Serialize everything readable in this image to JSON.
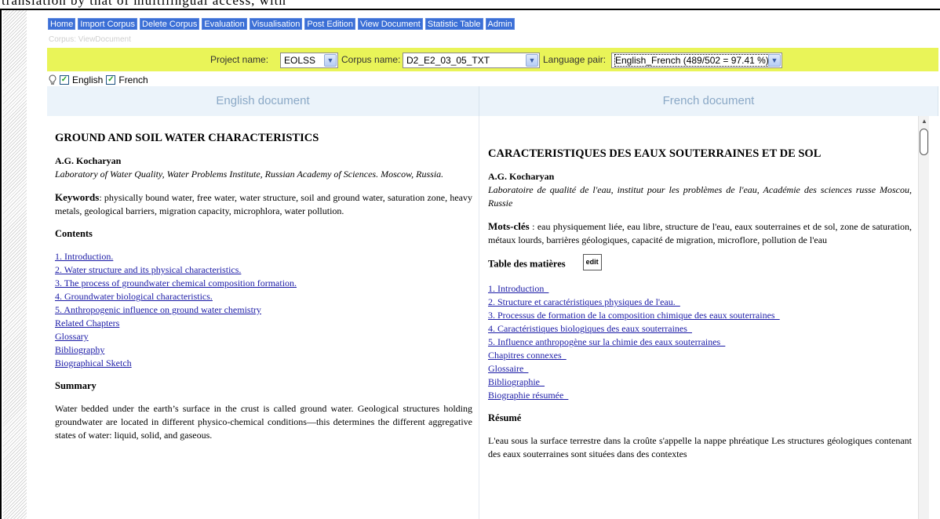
{
  "top_text": "translation by that of multilingual access, with",
  "nav": [
    "Home",
    "Import Corpus",
    "Delete Corpus",
    "Evaluation",
    "Visualisation",
    "Post Edition",
    "View Document",
    "Statistic Table",
    "Admin"
  ],
  "breadcrumb": "Corpus: ViewDocument",
  "selectors": {
    "project_label": "Project name:",
    "project_value": "EOLSS",
    "corpus_label": "Corpus name:",
    "corpus_value": "D2_E2_03_05_TXT",
    "language_label": "Language pair:",
    "language_value": "English_French (489/502 = 97.41 %)"
  },
  "toggles": {
    "english": "English",
    "french": "French"
  },
  "english": {
    "header": "English document",
    "title": "GROUND AND SOIL WATER CHARACTERISTICS",
    "author": "A.G. Kocharyan",
    "affiliation": "Laboratory of Water Quality, Water Problems Institute, Russian Academy of Sciences. Moscow, Russia.",
    "keywords_label": "Keywords",
    "keywords": ": physically bound water, free water, water structure, soil and ground water, saturation zone, heavy metals, geological barriers, migration capacity, microphlora, water pollution.",
    "contents_heading": "Contents",
    "links": [
      "1. Introduction.",
      "2. Water structure and its physical characteristics.",
      "3. The process of groundwater chemical composition formation.",
      "4. Groundwater biological characteristics.",
      "5. Anthropogenic influence on ground water chemistry",
      "Related Chapters",
      "Glossary",
      "Bibliography",
      "Biographical Sketch"
    ],
    "summary_heading": "Summary",
    "summary": "Water bedded under the earth’s surface in the crust is called ground water. Geological structures holding groundwater are located in different physico-chemical conditions—this determines the different aggregative states of water: liquid, solid, and gaseous."
  },
  "french": {
    "header": "French document",
    "title": "CARACTERISTIQUES DES EAUX SOUTERRAINES ET DE SOL",
    "author": "A.G. Kocharyan",
    "affiliation": "Laboratoire de qualité de l'eau, institut pour les problèmes de l'eau, Académie des sciences russe  Moscou, Russie",
    "keywords_label": "Mots-clés",
    "keywords": " : eau physiquement liée, eau libre, structure de l'eau, eaux souterraines et de sol, zone de saturation, métaux lourds, barrières géologiques, capacité de migration, microflore, pollution de l'eau",
    "contents_heading": "Table des matières",
    "edit_label": "edit",
    "links": [
      "1. Introduction_",
      "2. Structure et caractéristiques physiques de l'eau._",
      "3. Processus de formation de la composition chimique des eaux souterraines_",
      "4. Caractéristiques biologiques des eaux souterraines_",
      "5. Influence anthropogène sur la chimie des eaux souterraines_",
      "Chapitres connexes_",
      "Glossaire_",
      "Bibliographie_",
      "Biographie résumée_"
    ],
    "summary_heading": "Résumé",
    "summary": "L'eau sous la surface terrestre dans la croûte s'appelle la nappe phréatique  Les structures géologiques contenant des eaux souterraines sont situées dans des contextes"
  }
}
